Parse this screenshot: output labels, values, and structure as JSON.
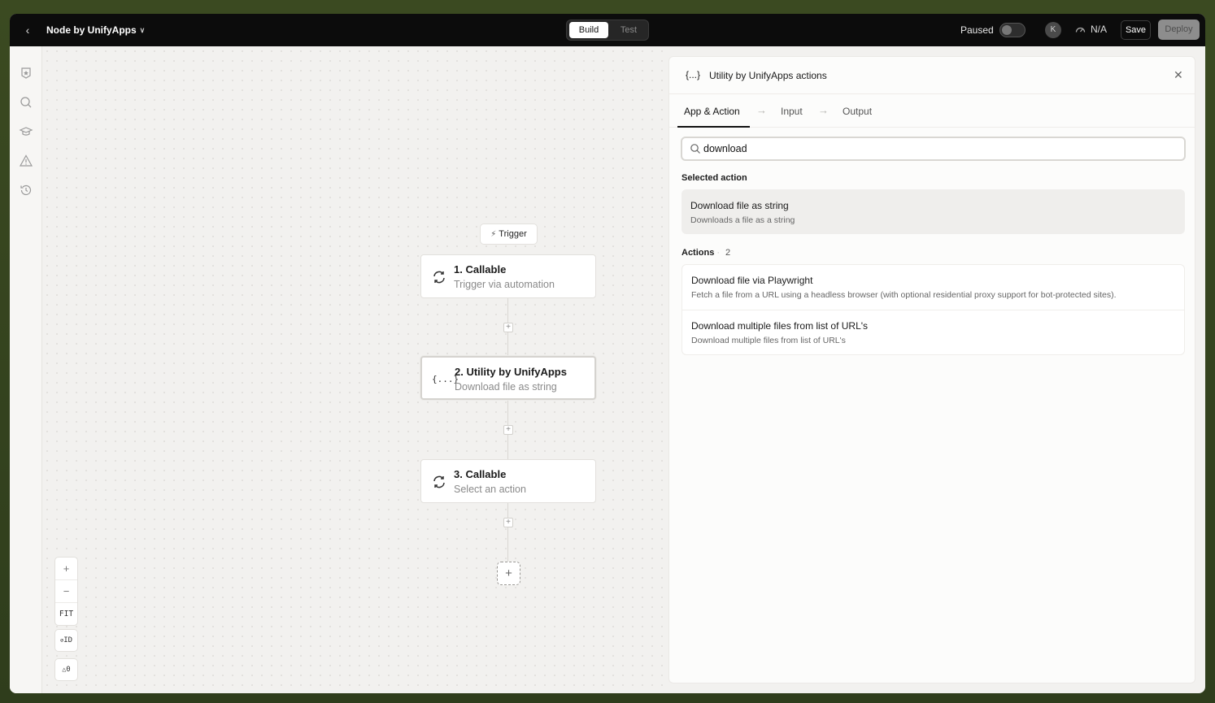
{
  "topbar": {
    "app_name": "Node by UnifyApps",
    "tabs": [
      "Build",
      "Test"
    ],
    "status_label": "Paused",
    "avatar_initial": "K",
    "gauge_label": "N/A",
    "save_label": "Save",
    "deploy_label": "Deploy"
  },
  "sidebar": {
    "icons": [
      "badge-star-icon",
      "search-icon",
      "graduation-cap-icon",
      "warning-triangle-icon",
      "history-icon"
    ]
  },
  "canvas": {
    "trigger_label": "Trigger",
    "nodes": [
      {
        "title": "1. Callable",
        "subtitle": "Trigger via automation",
        "icon": "sync-icon"
      },
      {
        "title": "2. Utility by UnifyApps",
        "subtitle": "Download file as string",
        "icon": "braces-icon"
      },
      {
        "title": "3. Callable",
        "subtitle": "Select an action",
        "icon": "sync-icon"
      }
    ],
    "zoom": {
      "in": "+",
      "out": "−",
      "fit": "FIT"
    },
    "id_toggle": "ID",
    "warnings_count": "0"
  },
  "panel": {
    "icon_text": "{...}",
    "title": "Utility by UnifyApps actions",
    "tabs": [
      "App & Action",
      "Input",
      "Output"
    ],
    "search": {
      "value": "download",
      "placeholder": "Search actions"
    },
    "selected_label": "Selected action",
    "selected_action": {
      "title": "Download file as string",
      "description": "Downloads a file as a string"
    },
    "actions_label": "Actions",
    "actions_count": "2",
    "actions": [
      {
        "title": "Download file via Playwright",
        "description": "Fetch a file from a URL using a headless browser (with optional residential proxy support for bot-protected sites)."
      },
      {
        "title": "Download multiple files from list of URL's",
        "description": "Download multiple files from list of URL's"
      }
    ]
  },
  "colors": {
    "topbar": "#0c0c0c",
    "canvas": "#f2f1ef",
    "accent": "#111111"
  }
}
